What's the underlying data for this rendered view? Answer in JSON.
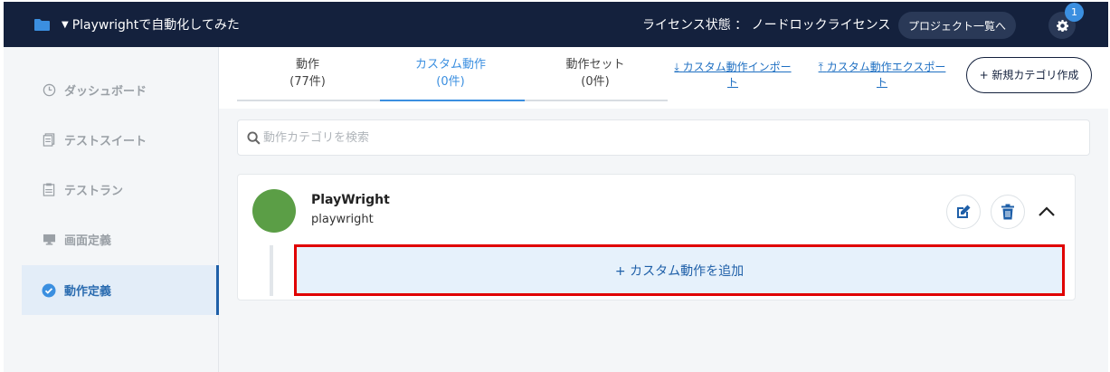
{
  "header": {
    "project_name": "Playwrightで自動化してみた",
    "license": "ライセンス状態 ： ノードロックライセンス",
    "project_list_label": "プロジェクト一覧へ",
    "notification_count": "1"
  },
  "sidebar": {
    "items": [
      {
        "label": "ダッシュボード",
        "icon": "clock-icon"
      },
      {
        "label": "テストスイート",
        "icon": "document-icon"
      },
      {
        "label": "テストラン",
        "icon": "clipboard-icon"
      },
      {
        "label": "画面定義",
        "icon": "monitor-icon"
      },
      {
        "label": "動作定義",
        "icon": "check-circle-icon",
        "active": true
      }
    ]
  },
  "tabs": [
    {
      "label": "動作",
      "count": "(77件)"
    },
    {
      "label": "カスタム動作",
      "count": "(0件)",
      "active": true
    },
    {
      "label": "動作セット",
      "count": "(0件)"
    }
  ],
  "actions": {
    "import_label": "カスタム動作インポート",
    "export_label": "カスタム動作エクスポート",
    "new_category_label": "+ 新規カテゴリ作成"
  },
  "search": {
    "placeholder": "動作カテゴリを検索"
  },
  "category": {
    "title": "PlayWright",
    "subtitle": "playwright",
    "avatar_color": "#5b9e46",
    "add_label": "+ カスタム動作を追加"
  },
  "colors": {
    "header_bg": "#14213d",
    "accent": "#3b8fe0",
    "highlight": "#e00000"
  }
}
